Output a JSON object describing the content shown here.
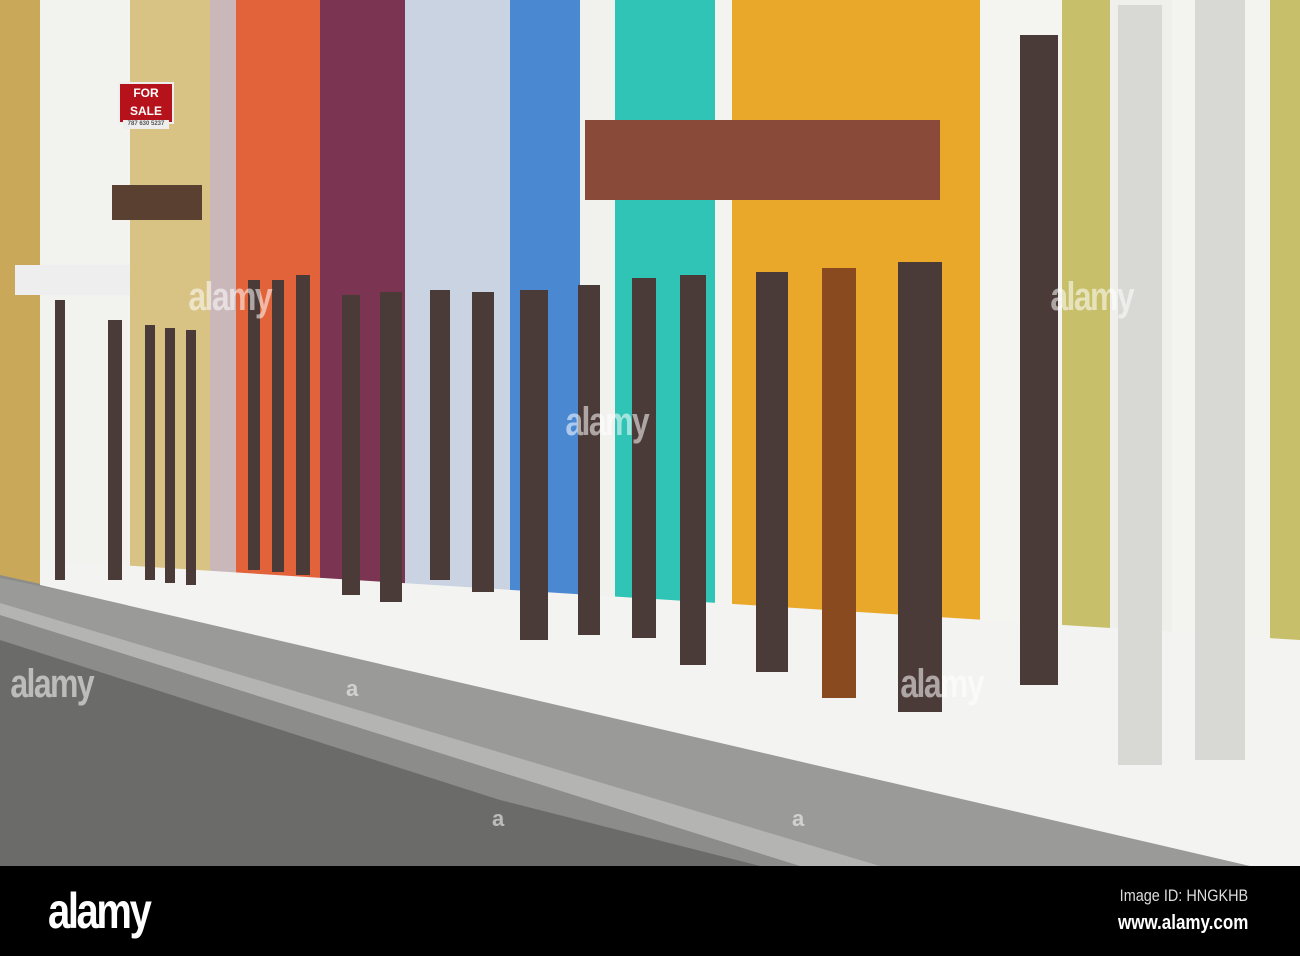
{
  "photo": {
    "subject": "Colorful colonial facades along a cobblestone street",
    "sign_text": "FOR SALE",
    "sign_phone": "787 630 5237",
    "watermark": "alamy",
    "watermark_mark": "a"
  },
  "footer": {
    "logo": "alamy",
    "image_id": "Image ID: HNGKHB",
    "url": "www.alamy.com"
  },
  "colors": {
    "khaki": "#d8c384",
    "orange": "#e2623a",
    "purple": "#7b3452",
    "lightblue": "#c9d3e1",
    "blue": "#4b88d2",
    "teal": "#2fc4b6",
    "yellow": "#e9a82a",
    "olive": "#c8bf6a"
  }
}
